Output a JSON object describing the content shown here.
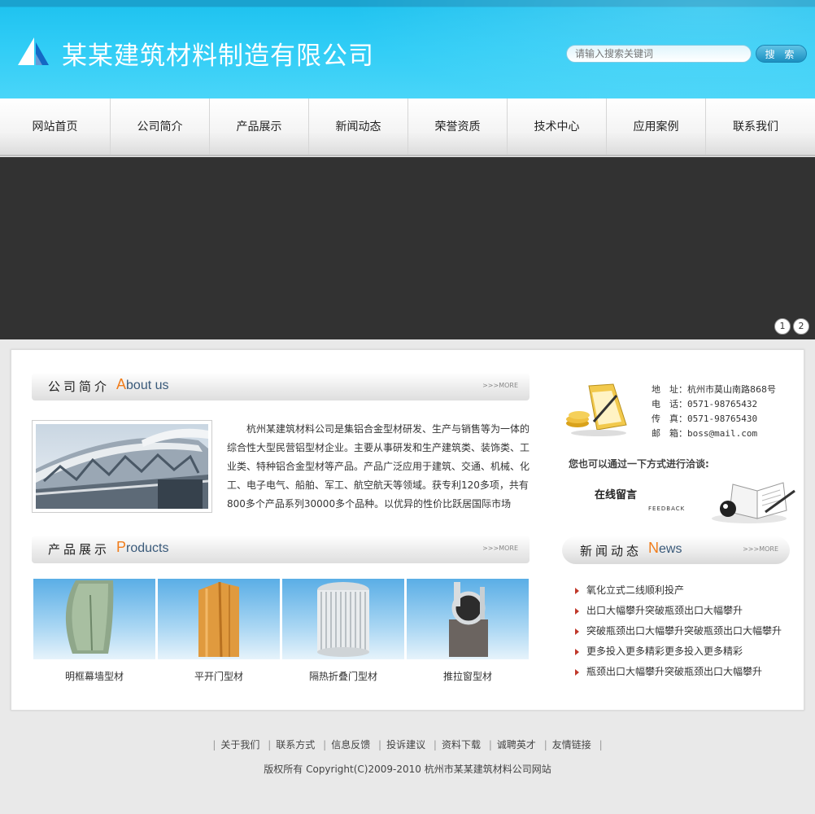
{
  "header": {
    "title": "某某建筑材料制造有限公司",
    "search_placeholder": "请输入搜索关键词",
    "search_button": "搜 索"
  },
  "nav": [
    "网站首页",
    "公司简介",
    "产品展示",
    "新闻动态",
    "荣誉资质",
    "技术中心",
    "应用案例",
    "联系我们"
  ],
  "banner": {
    "pages": [
      "1",
      "2"
    ]
  },
  "about": {
    "title_cn": "公司简介",
    "title_en_initial": "A",
    "title_en_rest": "bout us",
    "more": ">>>MORE",
    "text": "杭州某建筑材料公司是集铝合金型材研发、生产与销售等为一体的综合性大型民营铝型材企业。主要从事研发和生产建筑类、装饰类、工业类、特种铝合金型材等产品。产品广泛应用于建筑、交通、机械、化工、电子电气、船舶、军工、航空航天等领域。获专利120多项，共有800多个产品系列30000多个品种。以优异的性价比跃居国际市场"
  },
  "products": {
    "title_cn": "产品展示",
    "title_en_initial": "P",
    "title_en_rest": "roducts",
    "more": ">>>MORE",
    "items": [
      {
        "name": "明框幕墙型材"
      },
      {
        "name": "平开门型材"
      },
      {
        "name": "隔热折叠门型材"
      },
      {
        "name": "推拉窗型材"
      }
    ]
  },
  "contact": {
    "address_label": "地　址：",
    "address": "杭州市莫山南路868号",
    "phone_label": "电　话：",
    "phone": "0571-98765432",
    "fax_label": "传　真：",
    "fax": "0571-98765430",
    "email_label": "邮　箱：",
    "email": "boss@mail.com",
    "note": "您也可以通过一下方式进行洽谈:",
    "feedback_cn": "在线留言",
    "feedback_en": "FEEDBACK"
  },
  "news": {
    "title_cn": "新闻动态",
    "title_en_initial": "N",
    "title_en_rest": "ews",
    "more": ">>>MORE",
    "items": [
      "氧化立式二线顺利投产",
      "出口大幅攀升突破瓶颈出口大幅攀升",
      "突破瓶颈出口大幅攀升突破瓶颈出口大幅攀升",
      "更多投入更多精彩更多投入更多精彩",
      "瓶颈出口大幅攀升突破瓶颈出口大幅攀升"
    ]
  },
  "footer": {
    "links": [
      "关于我们",
      "联系方式",
      "信息反馈",
      "投诉建议",
      "资料下载",
      "诚聘英才",
      "友情链接"
    ],
    "copyright": "版权所有 Copyright(C)2009-2010 杭州市某某建筑材料公司网站"
  },
  "colors": {
    "header_blue": "#31cdf6",
    "accent_orange": "#f07d1c",
    "banner_dark": "#323232"
  }
}
